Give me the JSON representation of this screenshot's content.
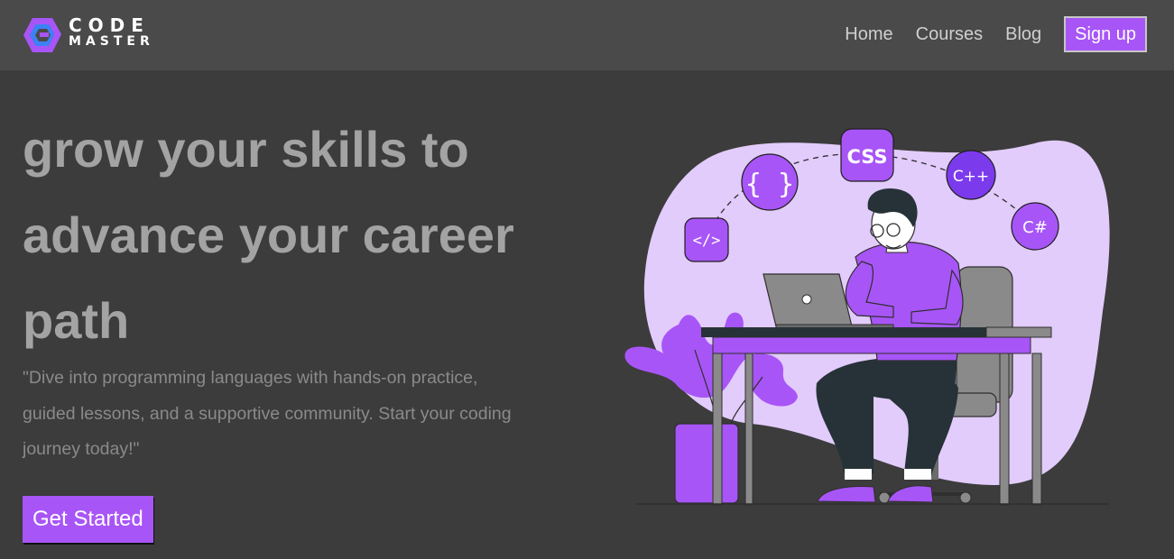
{
  "brand": {
    "line1": "CODE",
    "line2": "MASTER",
    "colors": {
      "primary": "#a855f7",
      "dark": "#6d28d9",
      "light": "#e2ccfb"
    }
  },
  "nav": {
    "links": [
      "Home",
      "Courses",
      "Blog"
    ],
    "signup": "Sign up"
  },
  "hero": {
    "headline": "grow your skills to advance your career path",
    "subtext": "\"Dive into programming languages with hands-on practice, guided lessons, and a supportive community. Start your coding journey today!\"",
    "cta": "Get Started"
  },
  "illustration": {
    "badges": [
      "</>",
      "{ }",
      "CSS",
      "C++",
      "C#"
    ]
  },
  "colors": {
    "background": "#3c3c3c",
    "navbar": "#4a4a4a",
    "headline": "#a3a3a3",
    "subtext": "#8a8a8a"
  }
}
